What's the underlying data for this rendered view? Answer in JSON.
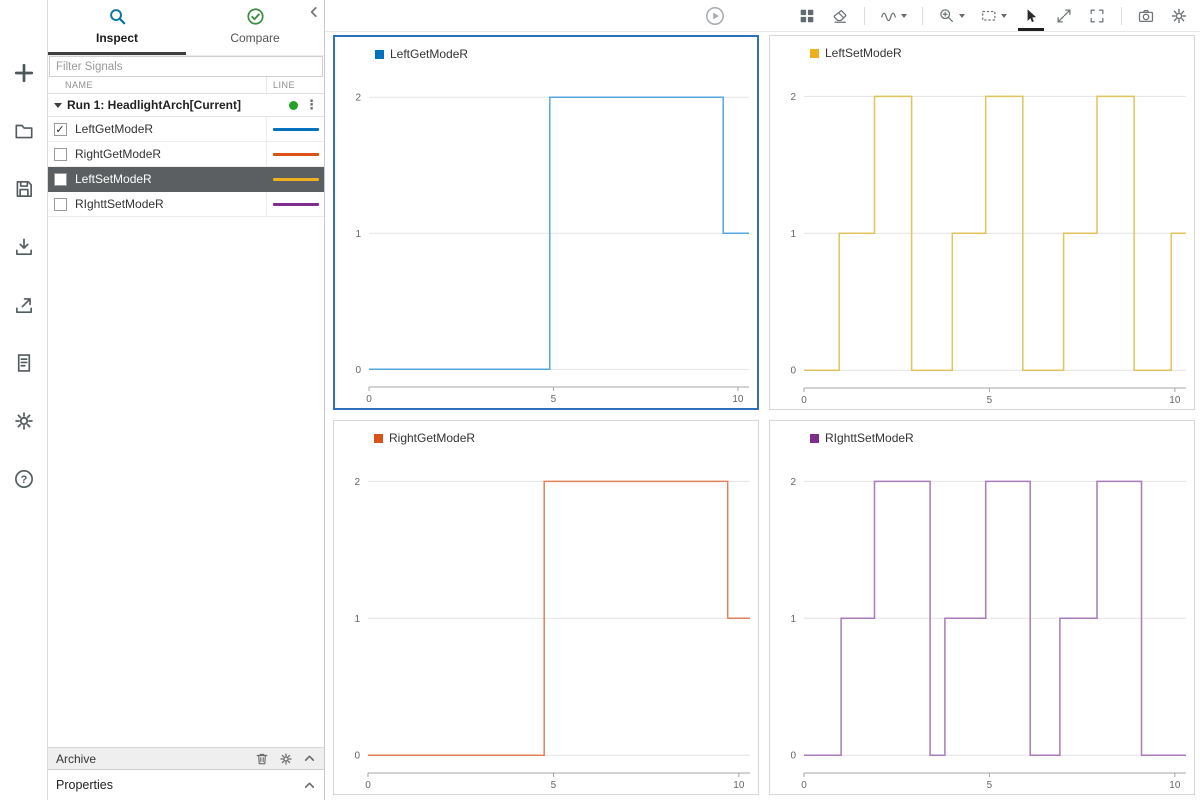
{
  "colors": {
    "selection_blue": "#2F6FBD",
    "selected_row_bg": "#5B5F61",
    "run_status_green": "#23A127",
    "inspect_icon_blue": "#0B77A8",
    "compare_icon_green": "#3D8B40"
  },
  "rail": {
    "icons": [
      "new",
      "open",
      "save",
      "import",
      "export",
      "report",
      "preferences",
      "help"
    ]
  },
  "sidebar": {
    "tabs": [
      {
        "label": "Inspect",
        "active": true
      },
      {
        "label": "Compare",
        "active": false
      }
    ],
    "filter_placeholder": "Filter Signals",
    "columns": [
      "NAME",
      "LINE"
    ],
    "run": {
      "label": "Run 1: HeadlightArch[Current]"
    },
    "signals": [
      {
        "name": "LeftGetModeR",
        "checked": true,
        "selected": false,
        "color": "#0072BD"
      },
      {
        "name": "RightGetModeR",
        "checked": false,
        "selected": false,
        "color": "#D95319"
      },
      {
        "name": "LeftSetModeR",
        "checked": false,
        "selected": true,
        "color": "#EDB120"
      },
      {
        "name": "RIghttSetModeR",
        "checked": false,
        "selected": false,
        "color": "#7E2F8E"
      }
    ],
    "archive_label": "Archive",
    "properties_label": "Properties"
  },
  "main_toolbar": {
    "icons": [
      "run",
      "layout-grid",
      "eraser",
      "signal-trace",
      "zoom",
      "region-select",
      "pointer",
      "expand",
      "fit-to-view",
      "snapshot",
      "settings"
    ]
  },
  "chart_data": [
    {
      "type": "step",
      "title": "LeftGetModeR",
      "legend_color": "#0072BD",
      "line_color": "#56A7DF",
      "x": [
        0,
        4.9,
        9.6
      ],
      "y": [
        0,
        2,
        1
      ],
      "xlim": [
        0,
        10.3
      ],
      "ylim": [
        -0.13,
        2.2
      ],
      "xticks": [
        0,
        5,
        10
      ],
      "yticks": [
        0,
        1,
        2
      ],
      "selected": true
    },
    {
      "type": "step",
      "title": "LeftSetModeR",
      "legend_color": "#EDB120",
      "line_color": "#E2C35C",
      "x": [
        0,
        0.95,
        1.9,
        2.9,
        4,
        4.9,
        5.9,
        7,
        7.9,
        8.9,
        9.9
      ],
      "y": [
        0,
        1,
        2,
        0,
        1,
        2,
        0,
        1,
        2,
        0,
        1
      ],
      "xlim": [
        0,
        10.3
      ],
      "ylim": [
        -0.13,
        2.2
      ],
      "xticks": [
        0,
        5,
        10
      ],
      "yticks": [
        0,
        1,
        2
      ],
      "selected": false
    },
    {
      "type": "step",
      "title": "RightGetModeR",
      "legend_color": "#D95319",
      "line_color": "#E0815A",
      "x": [
        0,
        4.75,
        9.7
      ],
      "y": [
        0,
        2,
        1
      ],
      "xlim": [
        0,
        10.3
      ],
      "ylim": [
        -0.13,
        2.2
      ],
      "xticks": [
        0,
        5,
        10
      ],
      "yticks": [
        0,
        1,
        2
      ],
      "selected": false
    },
    {
      "type": "step",
      "title": "RIghttSetModeR",
      "legend_color": "#7E2F8E",
      "line_color": "#A97BB9",
      "x": [
        0,
        1,
        1.9,
        3.4,
        3.8,
        4.9,
        6.1,
        6.9,
        7.9,
        9.1
      ],
      "y": [
        0,
        1,
        2,
        0,
        1,
        2,
        0,
        1,
        2,
        0
      ],
      "xlim": [
        0,
        10.3
      ],
      "ylim": [
        -0.13,
        2.2
      ],
      "xticks": [
        0,
        5,
        10
      ],
      "yticks": [
        0,
        1,
        2
      ],
      "selected": false
    }
  ]
}
